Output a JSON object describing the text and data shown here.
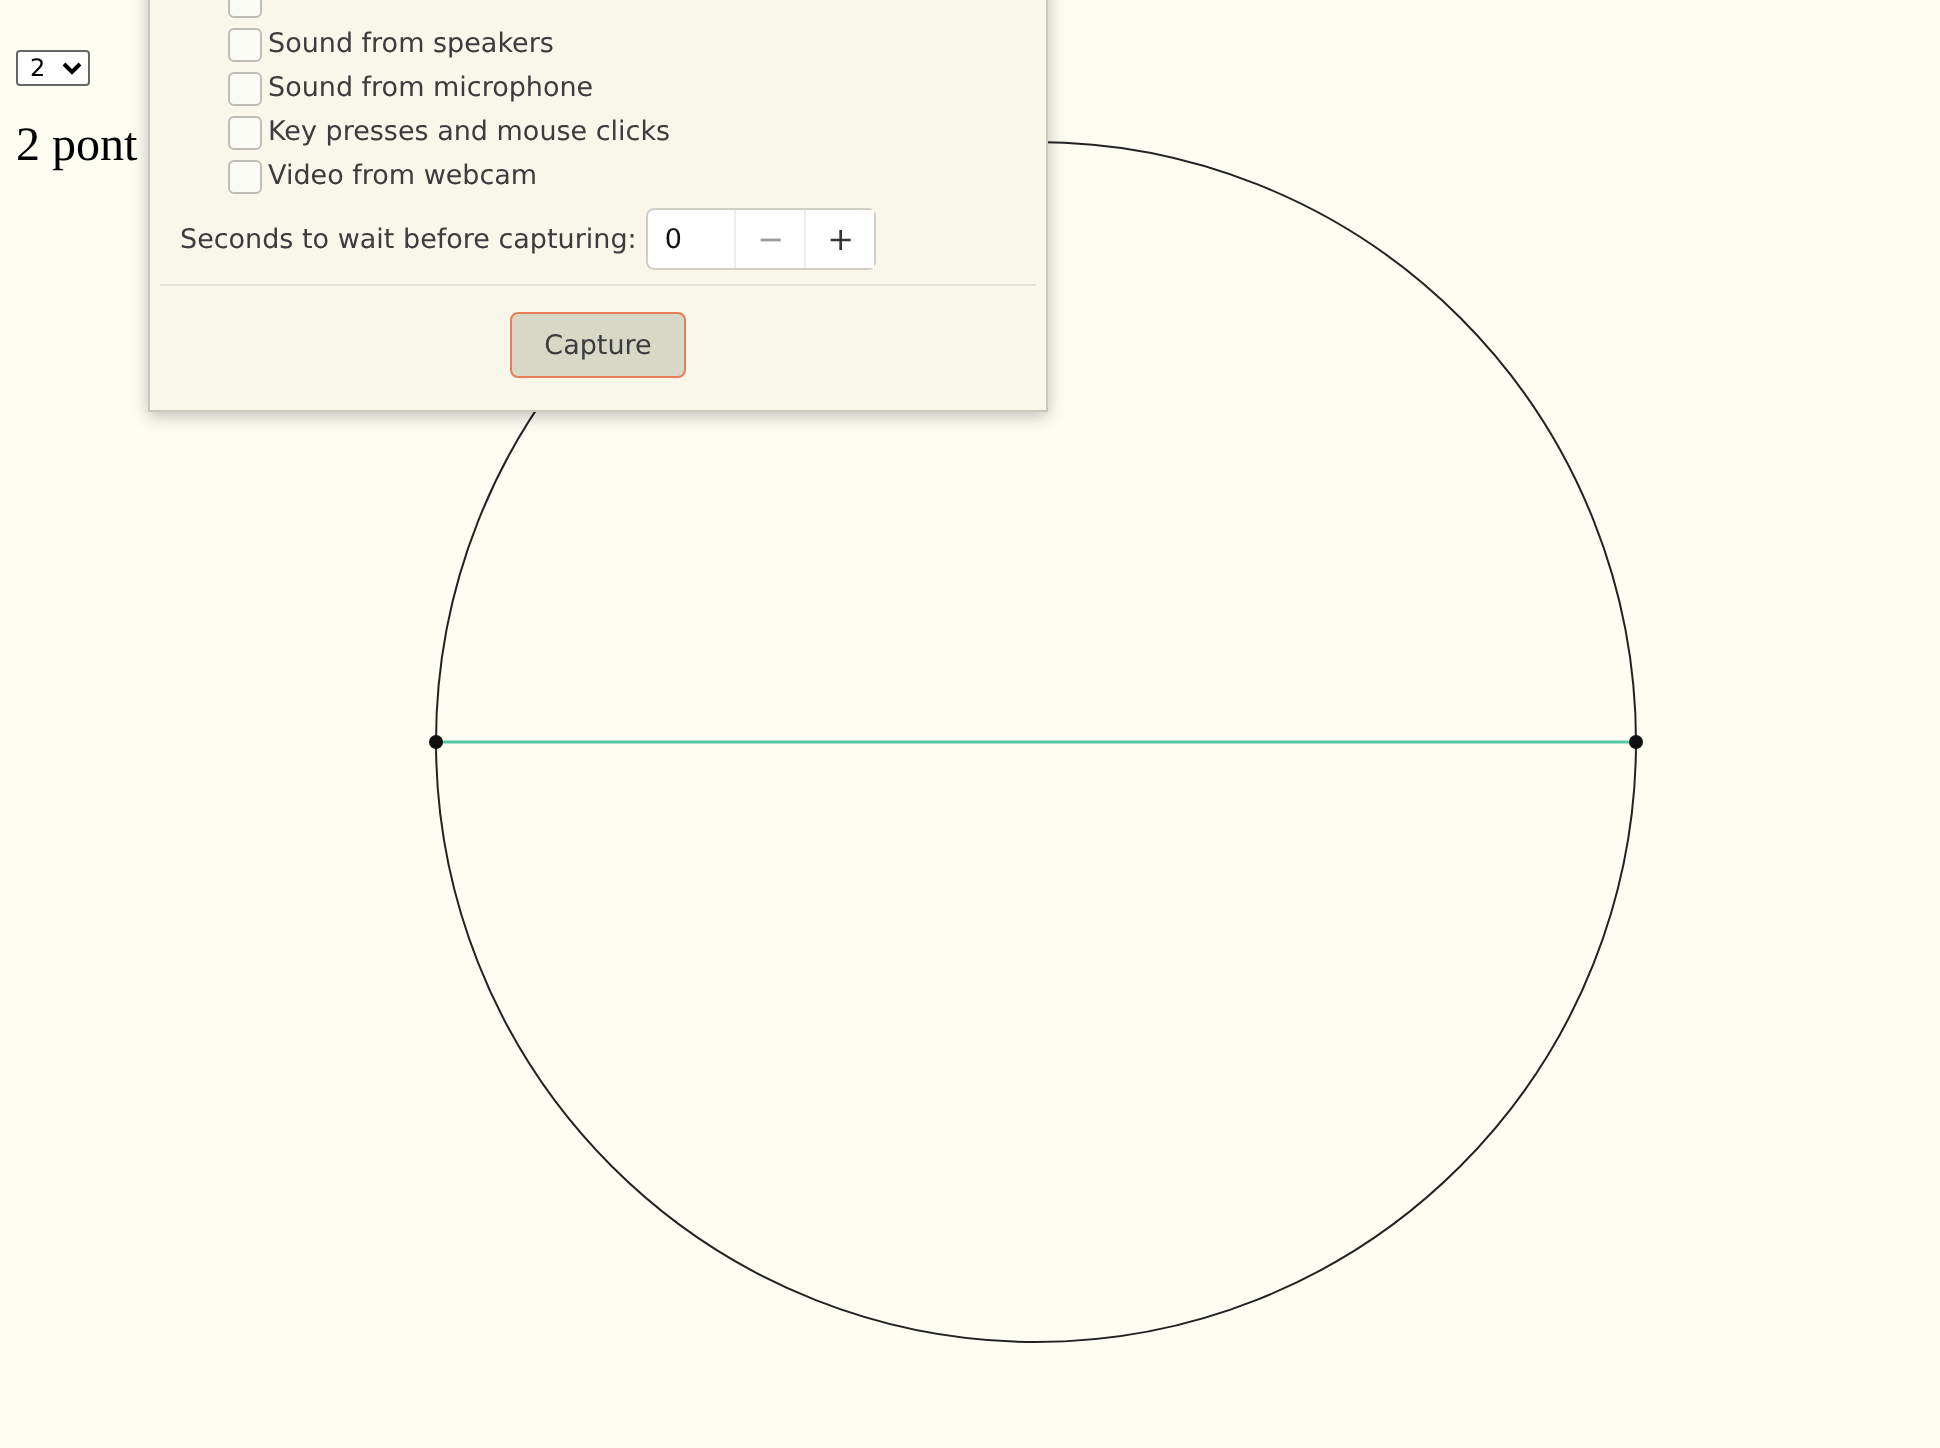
{
  "page": {
    "count_select": {
      "value": "2"
    },
    "heading": "2 pont"
  },
  "diagram": {
    "points": [
      {
        "kind": "endpoint"
      },
      {
        "kind": "endpoint"
      }
    ]
  },
  "capture_dialog": {
    "options": [
      {
        "checked": false
      },
      {
        "label": "Sound from speakers",
        "checked": false
      },
      {
        "label": "Sound from microphone",
        "checked": false
      },
      {
        "label": "Key presses and mouse clicks",
        "checked": false
      },
      {
        "label": "Video from webcam",
        "checked": false
      }
    ],
    "delay": {
      "label": "Seconds to wait before capturing:",
      "value": "0",
      "decrement": "−",
      "increment": "+"
    },
    "capture_button": "Capture"
  }
}
